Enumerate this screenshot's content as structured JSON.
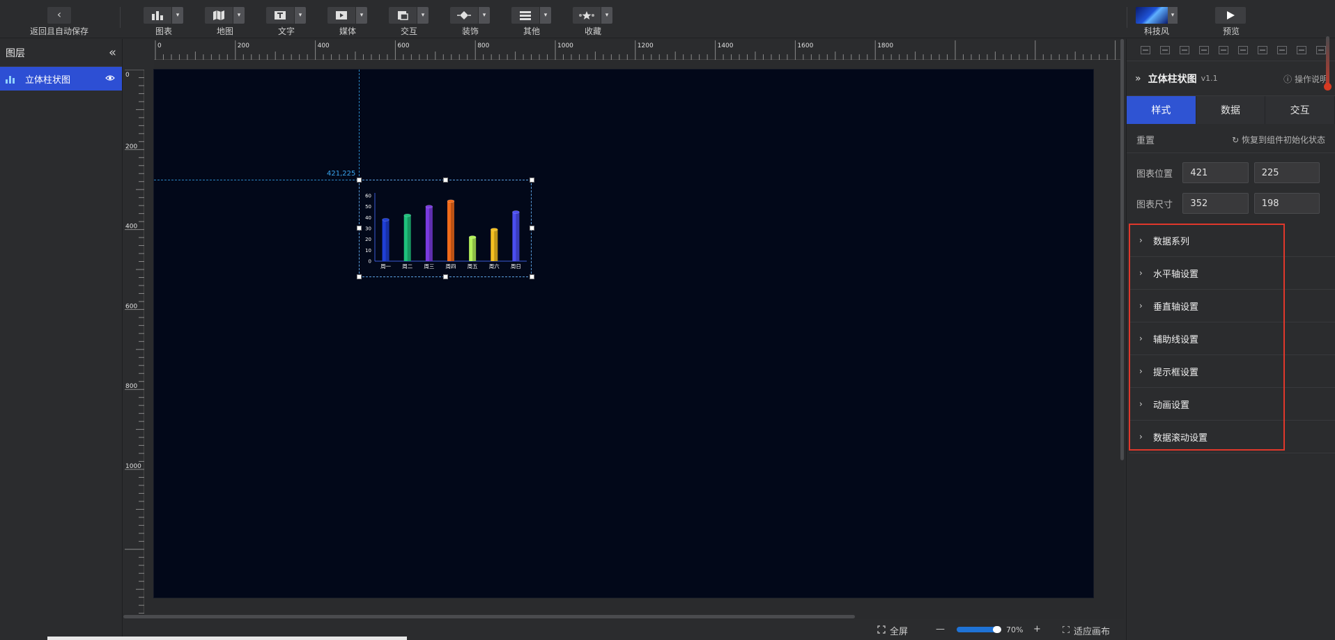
{
  "toolbar": {
    "back_label": "返回且自动保存",
    "tools": [
      {
        "label": "图表",
        "icon": "bar-chart-icon"
      },
      {
        "label": "地图",
        "icon": "map-icon"
      },
      {
        "label": "文字",
        "icon": "text-icon"
      },
      {
        "label": "媒体",
        "icon": "media-icon"
      },
      {
        "label": "交互",
        "icon": "interaction-icon"
      },
      {
        "label": "装饰",
        "icon": "decoration-icon"
      },
      {
        "label": "其他",
        "icon": "other-icon"
      },
      {
        "label": "收藏",
        "icon": "star-icon"
      }
    ],
    "theme_label": "科技风",
    "preview_label": "预览"
  },
  "layers": {
    "title": "图层",
    "items": [
      {
        "label": "立体柱状图"
      }
    ]
  },
  "ruler": {
    "h_ticks": [
      "0",
      "200",
      "400",
      "600",
      "800",
      "1000",
      "1200",
      "1400",
      "1600",
      "1800"
    ],
    "v_ticks": [
      "0",
      "200",
      "400",
      "600",
      "800",
      "1000"
    ]
  },
  "canvas": {
    "coord_readout": "421,225"
  },
  "chart_data": {
    "type": "bar",
    "categories": [
      "周一",
      "周二",
      "周三",
      "周四",
      "周五",
      "周六",
      "周日"
    ],
    "values": [
      38,
      42,
      50,
      55,
      22,
      29,
      45
    ],
    "colors": [
      "#1f3fd6",
      "#1ec17c",
      "#7a3be0",
      "#f06a1a",
      "#b4f25a",
      "#f5c021",
      "#4b4ef0"
    ],
    "ylim": [
      0,
      60
    ],
    "y_ticks": [
      "0",
      "10",
      "20",
      "30",
      "40",
      "50",
      "60"
    ],
    "title": "",
    "xlabel": "",
    "ylabel": ""
  },
  "bottom": {
    "fullscreen_label": "全屏",
    "zoom_minus": "—",
    "zoom_value": "70%",
    "zoom_fraction": 0.7,
    "zoom_plus": "+",
    "fit_label": "适应画布"
  },
  "props": {
    "component_name": "立体柱状图",
    "version": "v1.1",
    "help_label": "操作说明",
    "tabs": [
      "样式",
      "数据",
      "交互"
    ],
    "active_tab": "样式",
    "reset_label": "重置",
    "restore_label": "恢复到组件初始化状态",
    "position_label": "图表位置",
    "position_x": "421",
    "position_y": "225",
    "size_label": "图表尺寸",
    "size_w": "352",
    "size_h": "198",
    "groups": [
      "数据系列",
      "水平轴设置",
      "垂直轴设置",
      "辅助线设置",
      "提示框设置",
      "动画设置",
      "数据滚动设置"
    ]
  },
  "colors": {
    "accent": "#2f54d3",
    "canvas_bg": "#020819",
    "highlight": "#e0372b"
  }
}
